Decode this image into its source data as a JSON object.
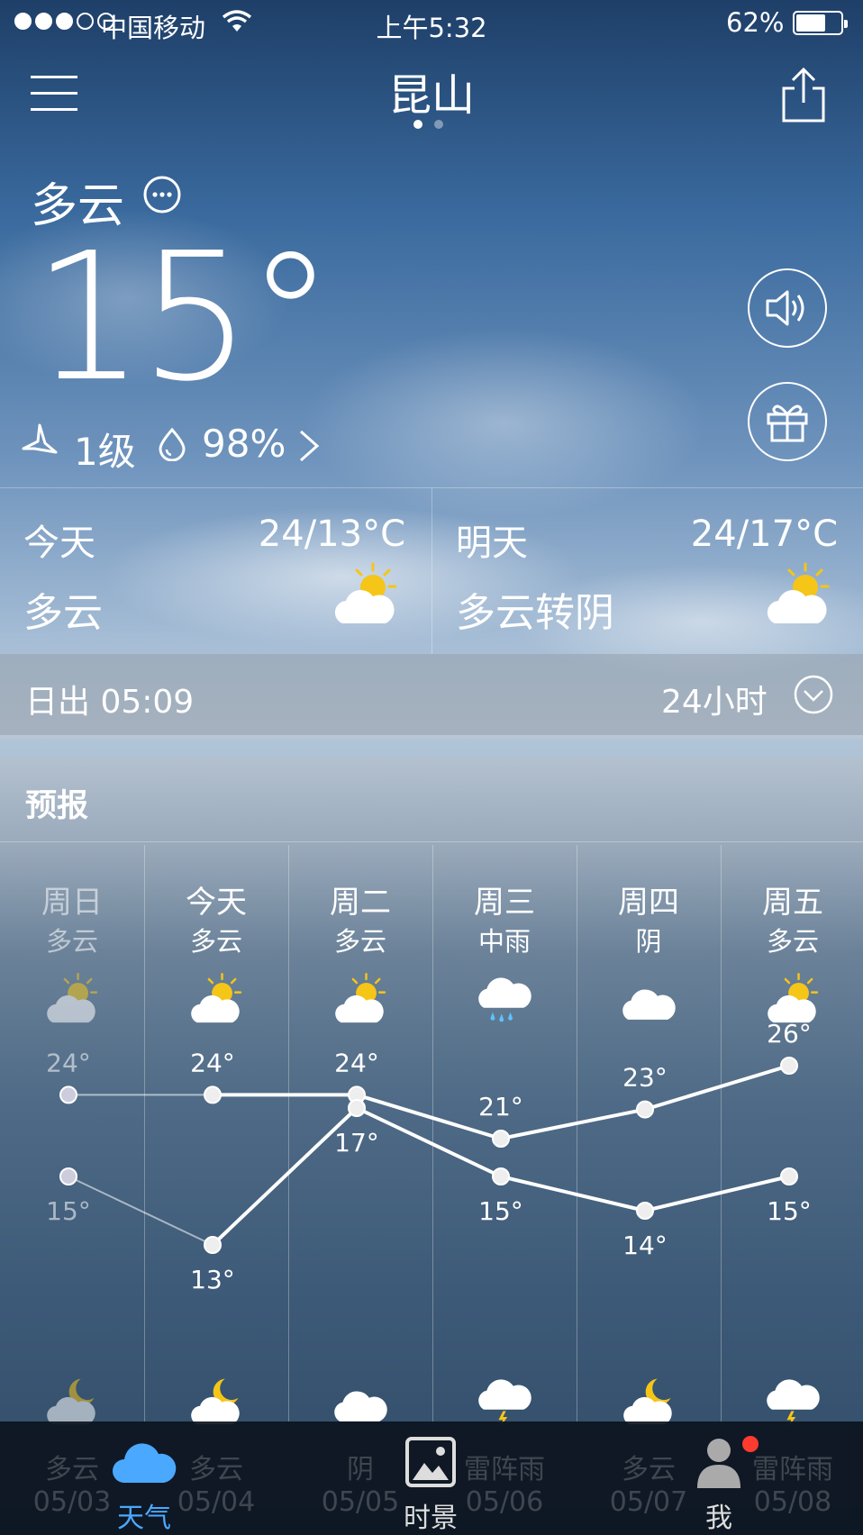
{
  "status_bar": {
    "carrier": "中国移动",
    "time": "上午5:32",
    "battery": "62%",
    "signal_bars_filled": 3,
    "signal_bars_total": 5
  },
  "header": {
    "city": "昆山",
    "page_count": 2,
    "active_page": 1
  },
  "current": {
    "condition": "多云",
    "temperature": "15°",
    "wind": "1级",
    "humidity": "98%"
  },
  "today": {
    "label": "今天",
    "range": "24/13°C",
    "condition": "多云"
  },
  "tomorrow": {
    "label": "明天",
    "range": "24/17°C",
    "condition": "多云转阴"
  },
  "sun": {
    "sunrise": "日出 05:09",
    "hours": "24小时"
  },
  "forecast": {
    "title": "预报",
    "days": [
      {
        "day": "周日",
        "cond": "多云",
        "high": "24°",
        "low": "15°",
        "day_icon": "partly-cloudy-day-icon",
        "night_icon": "partly-cloudy-night-icon"
      },
      {
        "day": "今天",
        "cond": "多云",
        "high": "24°",
        "low": "13°",
        "day_icon": "partly-cloudy-day-icon",
        "night_icon": "partly-cloudy-night-icon"
      },
      {
        "day": "周二",
        "cond": "多云",
        "high": "24°",
        "low": "17°",
        "day_icon": "partly-cloudy-day-icon",
        "night_icon": "cloudy-icon"
      },
      {
        "day": "周三",
        "cond": "中雨",
        "high": "21°",
        "low": "15°",
        "day_icon": "rain-icon",
        "night_icon": "thunderstorm-icon"
      },
      {
        "day": "周四",
        "cond": "阴",
        "high": "23°",
        "low": "14°",
        "day_icon": "cloudy-icon",
        "night_icon": "partly-cloudy-night-icon"
      },
      {
        "day": "周五",
        "cond": "多云",
        "high": "26°",
        "low": "15°",
        "day_icon": "partly-cloudy-day-icon",
        "night_icon": "thunderstorm-icon"
      }
    ]
  },
  "chart_data": {
    "type": "line",
    "categories": [
      "周日",
      "今天",
      "周二",
      "周三",
      "周四",
      "周五"
    ],
    "series": [
      {
        "values": [
          24,
          24,
          24,
          21,
          23,
          26
        ]
      },
      {
        "values": [
          15,
          13,
          17,
          15,
          14,
          15
        ]
      }
    ]
  },
  "behind_tabbar": [
    {
      "cond": "多云",
      "date": "05/03"
    },
    {
      "cond": "多云",
      "date": "05/04"
    },
    {
      "cond": "阴",
      "date": "05/05"
    },
    {
      "cond": "雷阵雨",
      "date": "05/06"
    },
    {
      "cond": "多云",
      "date": "05/07"
    },
    {
      "cond": "雷阵雨",
      "date": "05/08"
    }
  ],
  "tabs": [
    {
      "label": "天气",
      "active": true,
      "icon": "cloud-icon"
    },
    {
      "label": "时景",
      "active": false,
      "icon": "photo-icon"
    },
    {
      "label": "我",
      "active": false,
      "icon": "person-icon",
      "badge": true
    }
  ],
  "colors": {
    "tab_active": "#4aa8ff",
    "badge": "#ff3b30",
    "sun": "#f5c518"
  }
}
